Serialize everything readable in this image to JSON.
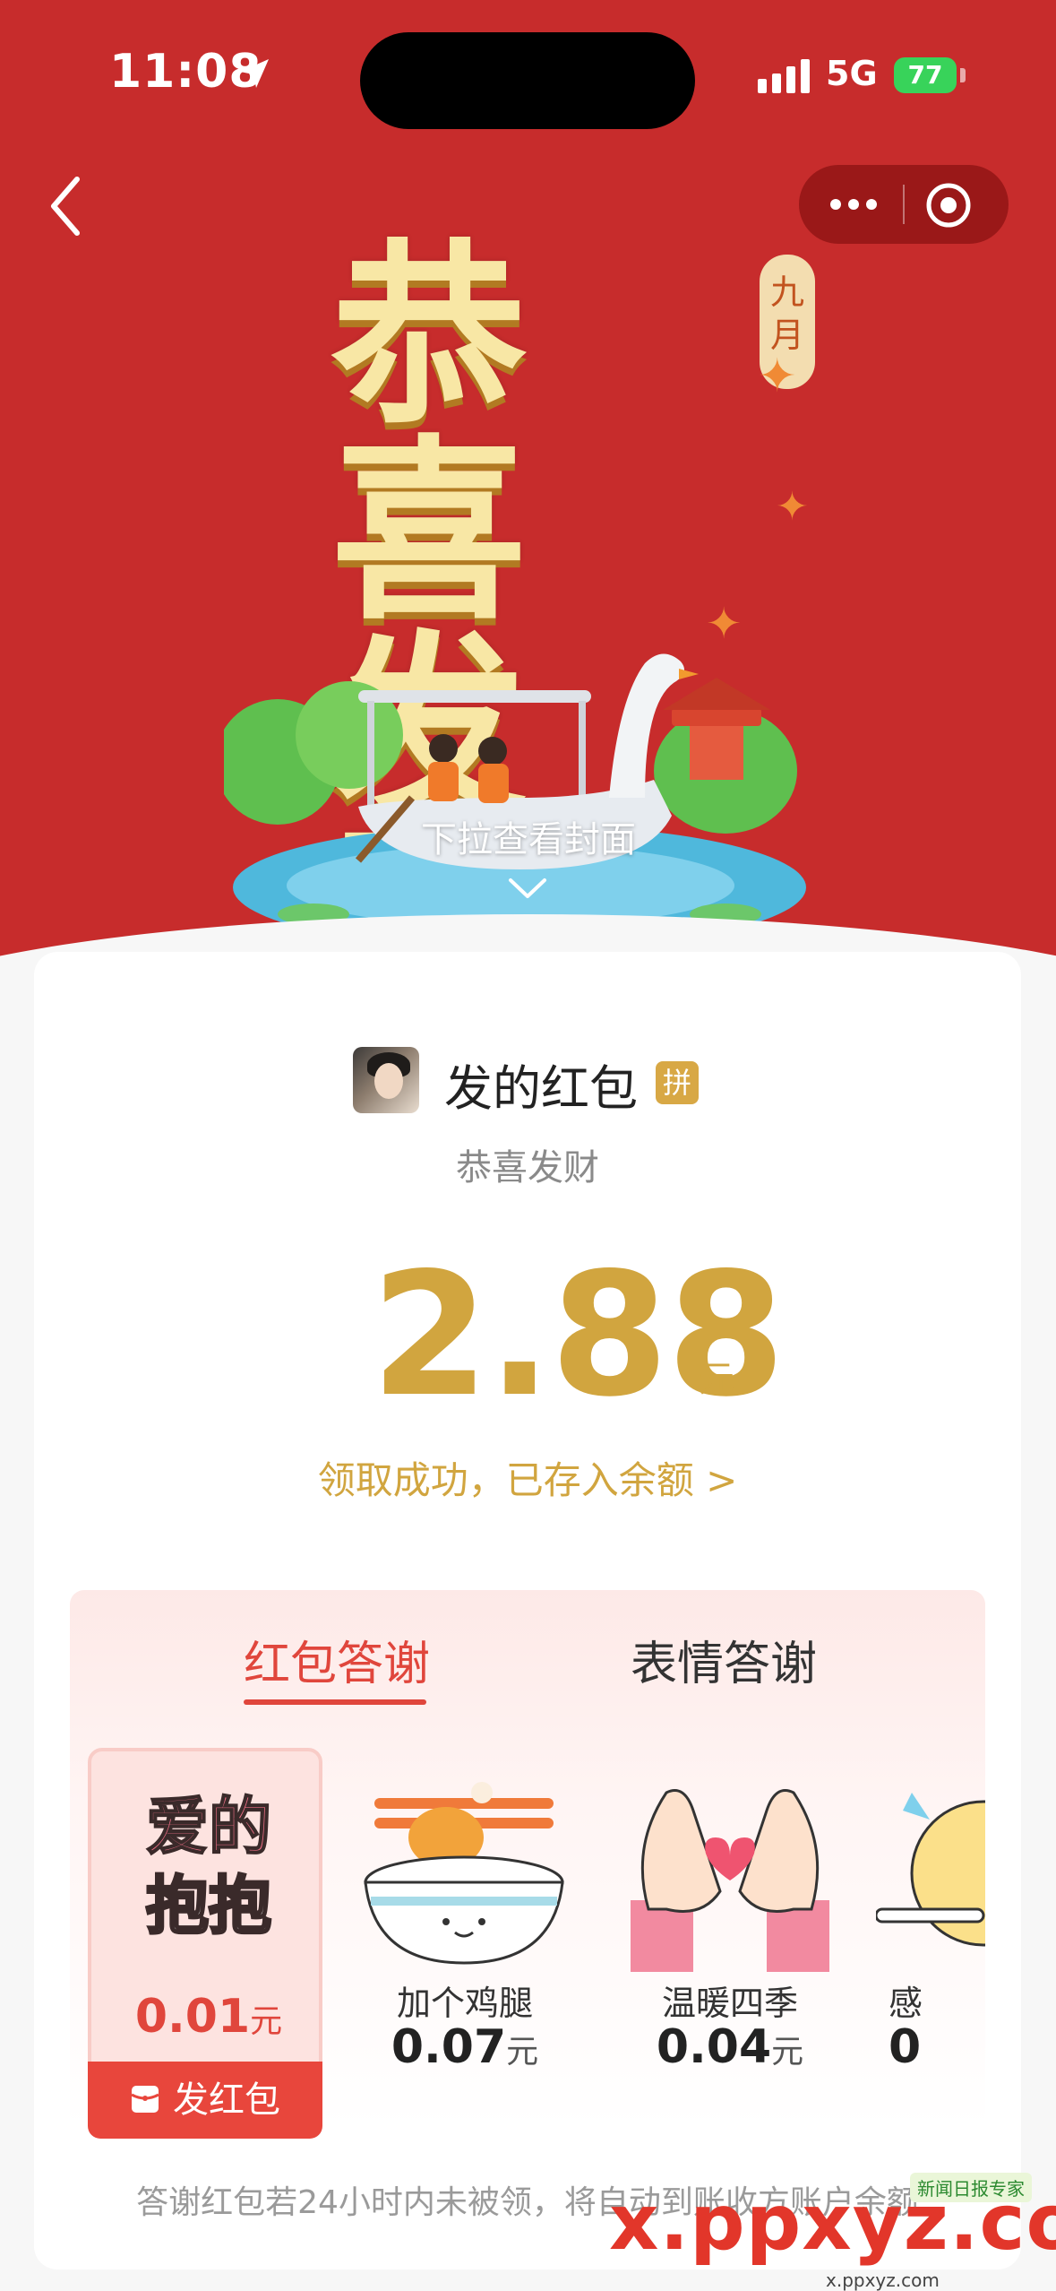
{
  "status_bar": {
    "time": "11:08",
    "network": "5G",
    "battery": "77"
  },
  "cover": {
    "title_line1": "恭喜",
    "title_line2": "发财",
    "month_tag": "九月",
    "pull_hint": "下拉查看封面"
  },
  "card": {
    "sender_name": "发的红包",
    "badge": "拼",
    "blessing": "恭喜发财",
    "amount": "2.88",
    "amount_unit": "元",
    "claimed_text": "领取成功，已存入余额 >"
  },
  "thanks": {
    "tabs": [
      {
        "label": "红包答谢",
        "active": true
      },
      {
        "label": "表情答谢",
        "active": false
      }
    ],
    "gifts": [
      {
        "art_text_1": "爱的",
        "art_text_2": "抱抱",
        "price": "0.01",
        "unit": "元",
        "selected": true,
        "button": "发红包"
      },
      {
        "name": "加个鸡腿",
        "price": "0.07",
        "unit": "元"
      },
      {
        "name": "温暖四季",
        "price": "0.04",
        "unit": "元"
      },
      {
        "name": "感",
        "price": "0",
        "unit": ""
      }
    ],
    "footer_note": "答谢红包若24小时内未被领，将自动到账收方账户余额"
  },
  "watermark": {
    "main": "x.ppxyz.com",
    "sub": "x.ppxyz.com",
    "badge": "新闻日报专家"
  },
  "colors": {
    "cover_red": "#c72c2c",
    "gold": "#d1a53f",
    "accent_red": "#e0463c"
  }
}
